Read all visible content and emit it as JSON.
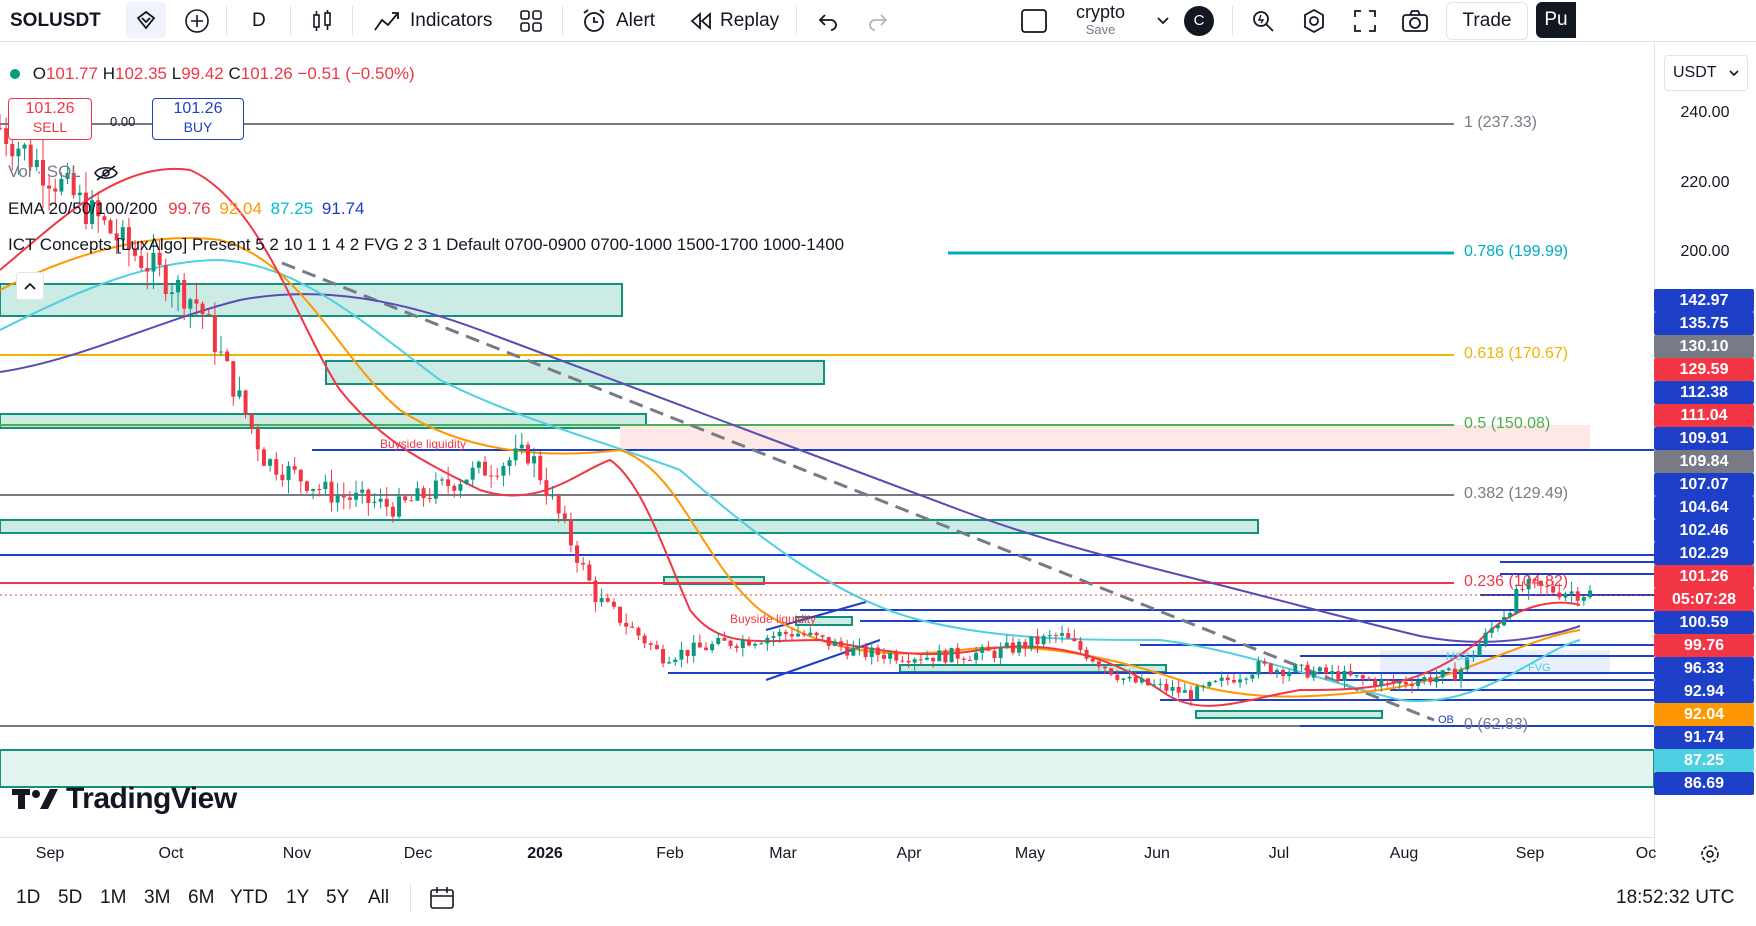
{
  "toolbar": {
    "symbol": "SOLUSDT",
    "interval": "D",
    "indicators_label": "Indicators",
    "alert_label": "Alert",
    "replay_label": "Replay",
    "layout_name": "crypto",
    "save_label": "Save",
    "avatar_letter": "C",
    "trade_label": "Trade",
    "publish_label": "Pu"
  },
  "legend": {
    "ohlc": {
      "o_label": "O",
      "o": "101.77",
      "h_label": "H",
      "h": "102.35",
      "l_label": "L",
      "l": "99.42",
      "c_label": "C",
      "c": "101.26",
      "chg": "−0.51 (−0.50%)"
    },
    "sell_price": "101.26",
    "sell_label": "SELL",
    "spread": "0.00",
    "buy_price": "101.26",
    "buy_label": "BUY",
    "vol_label": "Vol · SOL",
    "ema_label": "EMA 20/50/100/200",
    "ema_values": [
      "99.76",
      "92.04",
      "87.25",
      "91.74"
    ],
    "ict_label": "ICT Concepts [LuxAlgo] Present 5 2 10 1 1 4 2 FVG 2 3 1 Default 0700-0900 0700-1000 1500-1700 1000-1400"
  },
  "currency": "USDT",
  "colors": {
    "up": "#089981",
    "down": "#f23645",
    "ema20": "#f23645",
    "ema50": "#ff9800",
    "ema100": "#4dd0e1",
    "ema200": "#5b4bb7",
    "blue_level": "#1e40c8",
    "fvg_fill": "#bfe6df",
    "fvg_border": "#14917a"
  },
  "fib_labels": [
    {
      "text": "1 (237.33)",
      "color": "#787b86"
    },
    {
      "text": "0.786 (199.99)",
      "color": "#00acc1"
    },
    {
      "text": "0.618 (170.67)",
      "color": "#f0b400"
    },
    {
      "text": "0.5 (150.08)",
      "color": "#4caf50"
    },
    {
      "text": "0.382 (129.49)",
      "color": "#787b86"
    },
    {
      "text": "0.236 (104.82)",
      "color": "#f23645"
    },
    {
      "text": "0 (62.83)",
      "color": "#787b86"
    }
  ],
  "annotations": [
    "Buyside liquidity",
    "Buyside liquidity",
    "MSS",
    "FVG",
    "OB"
  ],
  "price_axis": [
    "240.00",
    "220.00",
    "200.00"
  ],
  "price_labels": [
    {
      "v": "142.97",
      "bg": "#1e40c8"
    },
    {
      "v": "135.75",
      "bg": "#1e40c8"
    },
    {
      "v": "130.10",
      "bg": "#787b86"
    },
    {
      "v": "129.59",
      "bg": "#f23645"
    },
    {
      "v": "112.38",
      "bg": "#1e40c8"
    },
    {
      "v": "111.04",
      "bg": "#f23645"
    },
    {
      "v": "109.91",
      "bg": "#1e40c8"
    },
    {
      "v": "109.84",
      "bg": "#787b86"
    },
    {
      "v": "107.07",
      "bg": "#1e40c8"
    },
    {
      "v": "104.64",
      "bg": "#1e40c8"
    },
    {
      "v": "102.46",
      "bg": "#1e40c8"
    },
    {
      "v": "102.29",
      "bg": "#1e40c8"
    },
    {
      "v": "101.26",
      "bg": "#f23645"
    },
    {
      "v": "05:07:28",
      "bg": "#f23645"
    },
    {
      "v": "100.59",
      "bg": "#1e40c8"
    },
    {
      "v": "99.76",
      "bg": "#f23645"
    },
    {
      "v": "96.33",
      "bg": "#1e40c8"
    },
    {
      "v": "92.94",
      "bg": "#1e40c8"
    },
    {
      "v": "92.04",
      "bg": "#ff9800"
    },
    {
      "v": "91.74",
      "bg": "#1e40c8"
    },
    {
      "v": "87.25",
      "bg": "#4dd0e1"
    },
    {
      "v": "86.69",
      "bg": "#1e40c8"
    }
  ],
  "time_axis": [
    "Sep",
    "Oct",
    "Nov",
    "Dec",
    "2026",
    "Feb",
    "Mar",
    "Apr",
    "May",
    "Jun",
    "Jul",
    "Aug",
    "Sep",
    "Oc"
  ],
  "ranges": [
    "1D",
    "5D",
    "1M",
    "3M",
    "6M",
    "YTD",
    "1Y",
    "5Y",
    "All"
  ],
  "clock": "18:52:32 UTC",
  "brand": "TradingView",
  "chart_data": {
    "type": "candlestick",
    "symbol": "SOLUSDT",
    "interval": "1D",
    "approx_close_path": [
      {
        "t": "Sep",
        "v": 236
      },
      {
        "t": "Oct",
        "v": 218
      },
      {
        "t": "Oct-mid",
        "v": 200
      },
      {
        "t": "Nov",
        "v": 185
      },
      {
        "t": "Nov-mid",
        "v": 140
      },
      {
        "t": "Dec",
        "v": 130
      },
      {
        "t": "Dec-mid",
        "v": 126
      },
      {
        "t": "2026",
        "v": 135
      },
      {
        "t": "2026-mid",
        "v": 142
      },
      {
        "t": "Feb",
        "v": 100
      },
      {
        "t": "Feb-mid",
        "v": 83
      },
      {
        "t": "Mar",
        "v": 87
      },
      {
        "t": "Mar-mid",
        "v": 90
      },
      {
        "t": "Apr",
        "v": 84
      },
      {
        "t": "Apr-mid",
        "v": 83
      },
      {
        "t": "May",
        "v": 84
      },
      {
        "t": "May-mid",
        "v": 89
      },
      {
        "t": "Jun",
        "v": 76
      },
      {
        "t": "Jun-mid",
        "v": 72
      },
      {
        "t": "Jul",
        "v": 80
      },
      {
        "t": "Jul-mid",
        "v": 78
      },
      {
        "t": "Aug",
        "v": 75
      },
      {
        "t": "Aug-mid",
        "v": 78
      },
      {
        "t": "Sep",
        "v": 103
      },
      {
        "t": "Sep-mid",
        "v": 101.26
      }
    ],
    "last": {
      "open": 101.77,
      "high": 102.35,
      "low": 99.42,
      "close": 101.26
    },
    "ema": {
      "ema20": 99.76,
      "ema50": 92.04,
      "ema100": 87.25,
      "ema200": 91.74
    },
    "fib_levels": [
      {
        "ratio": 1,
        "price": 237.33
      },
      {
        "ratio": 0.786,
        "price": 199.99
      },
      {
        "ratio": 0.618,
        "price": 170.67
      },
      {
        "ratio": 0.5,
        "price": 150.08
      },
      {
        "ratio": 0.382,
        "price": 129.49
      },
      {
        "ratio": 0.236,
        "price": 104.82
      },
      {
        "ratio": 0,
        "price": 62.83
      }
    ]
  }
}
